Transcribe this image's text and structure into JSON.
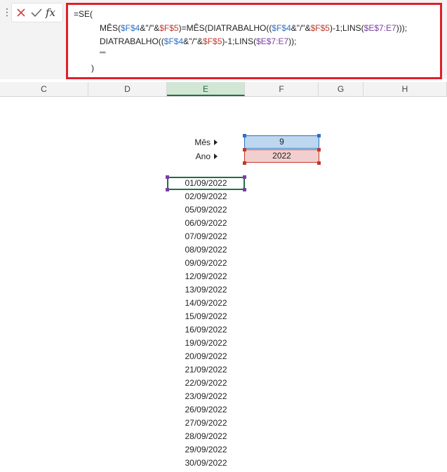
{
  "formula_bar": {
    "icons": [
      "cancel-icon",
      "enter-icon",
      "insert-function-icon"
    ],
    "fx_label": "fx",
    "lines": [
      [
        {
          "t": "=SE(",
          "c": ""
        }
      ],
      [
        {
          "t": "MÊS(",
          "c": ""
        },
        {
          "t": "$F$4",
          "c": "blue"
        },
        {
          "t": "&\"/\"&",
          "c": ""
        },
        {
          "t": "$F$5",
          "c": "red"
        },
        {
          "t": ")=MÊS(DIATRABALHO((",
          "c": ""
        },
        {
          "t": "$F$4",
          "c": "blue"
        },
        {
          "t": "&\"/\"&",
          "c": ""
        },
        {
          "t": "$F$5",
          "c": "red"
        },
        {
          "t": ")-1;LINS(",
          "c": ""
        },
        {
          "t": "$E$7:E7",
          "c": "purple"
        },
        {
          "t": ")));",
          "c": ""
        }
      ],
      [
        {
          "t": "DIATRABALHO((",
          "c": ""
        },
        {
          "t": "$F$4",
          "c": "blue"
        },
        {
          "t": "&\"/\"&",
          "c": ""
        },
        {
          "t": "$F$5",
          "c": "red"
        },
        {
          "t": ")-1;LINS(",
          "c": ""
        },
        {
          "t": "$E$7:E7",
          "c": "purple"
        },
        {
          "t": "));",
          "c": ""
        }
      ],
      [
        {
          "t": "\"\"",
          "c": ""
        }
      ],
      [
        {
          "t": ")",
          "c": ""
        }
      ]
    ]
  },
  "columns": [
    {
      "label": "C",
      "selected": false
    },
    {
      "label": "D",
      "selected": false
    },
    {
      "label": "E",
      "selected": true
    },
    {
      "label": "F",
      "selected": false
    },
    {
      "label": "G",
      "selected": false
    },
    {
      "label": "H",
      "selected": false
    }
  ],
  "inputs": {
    "mes_label": "Mês",
    "mes_value": "9",
    "ano_label": "Ano",
    "ano_value": "2022"
  },
  "dates": [
    "01/09/2022",
    "02/09/2022",
    "05/09/2022",
    "06/09/2022",
    "07/09/2022",
    "08/09/2022",
    "09/09/2022",
    "12/09/2022",
    "13/09/2022",
    "14/09/2022",
    "15/09/2022",
    "16/09/2022",
    "19/09/2022",
    "20/09/2022",
    "21/09/2022",
    "22/09/2022",
    "23/09/2022",
    "26/09/2022",
    "27/09/2022",
    "28/09/2022",
    "29/09/2022",
    "30/09/2022"
  ],
  "colors": {
    "ref_blue": "#2f6fc3",
    "ref_red": "#c4372b",
    "ref_purple": "#7b3fa0",
    "highlight_border": "#e0202a",
    "selection_green": "#1e7145"
  }
}
